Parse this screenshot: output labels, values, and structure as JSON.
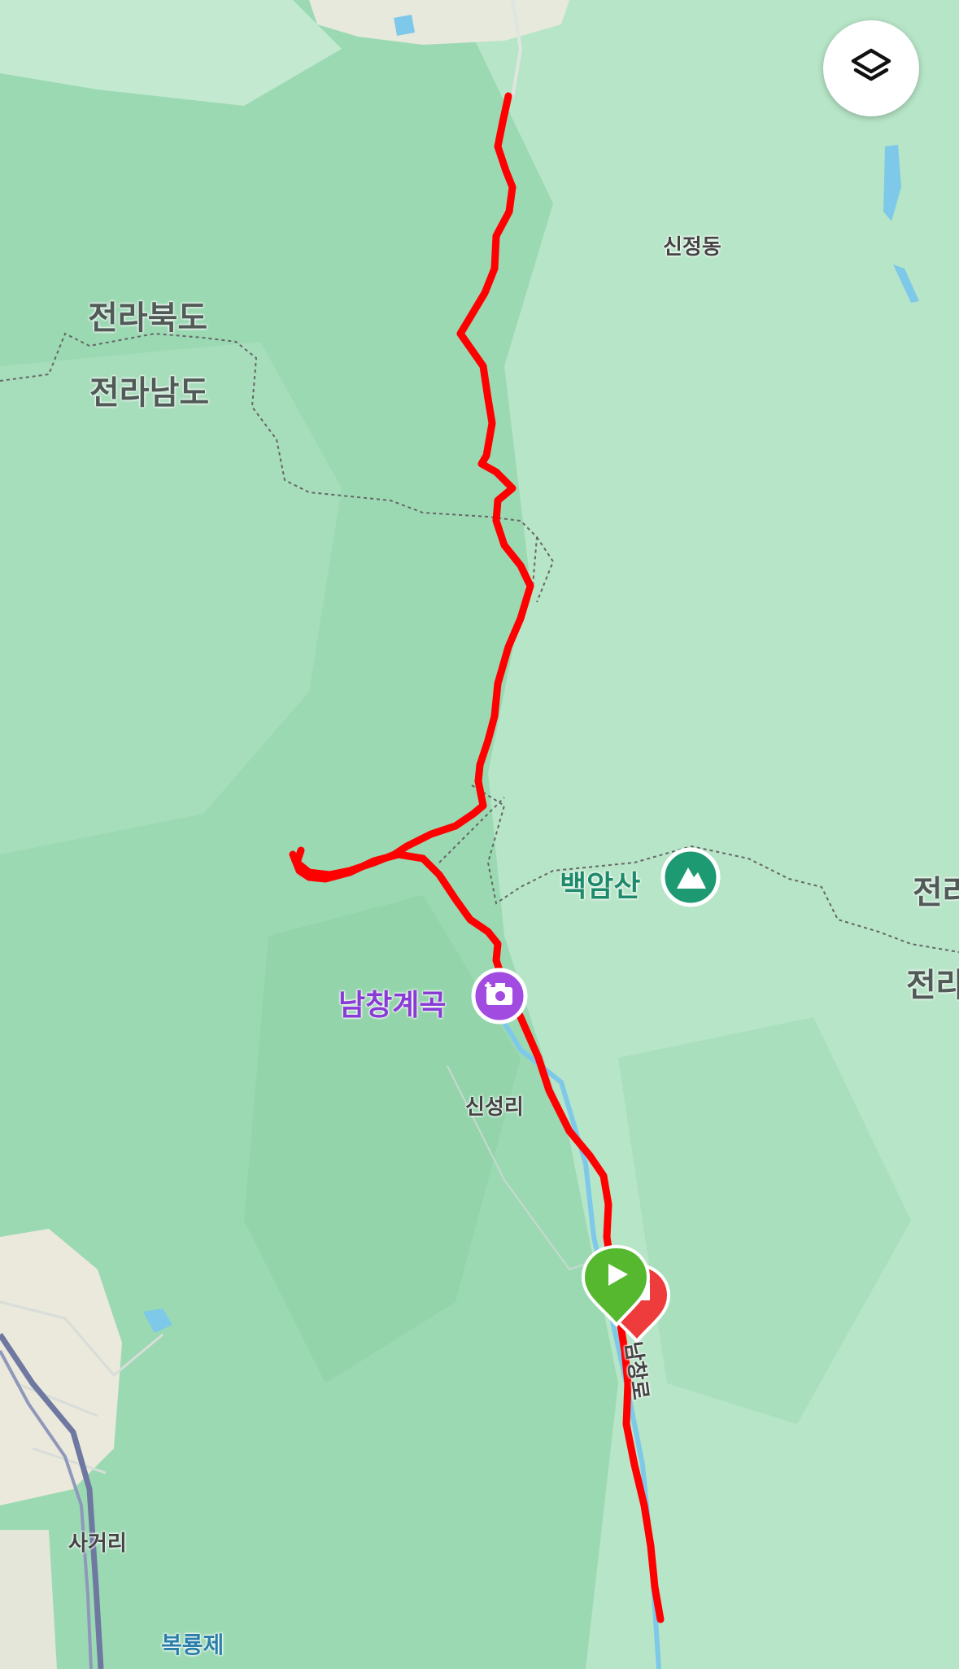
{
  "map": {
    "labels": {
      "region_north": "전라북도",
      "region_south": "전라남도",
      "region_north_right": "전라",
      "region_south_right": "전라",
      "village_sinjeong": "신정동",
      "village_sinseong": "신성리",
      "village_sageori": "사거리",
      "water_bokryongje": "복룡제",
      "road_namchang": "남창로"
    },
    "pois": {
      "mountain": {
        "label": "백암산",
        "icon": "mountain-icon",
        "color": "#1e9a72"
      },
      "valley": {
        "label": "남창계곡",
        "icon": "camera-icon",
        "color": "#a24be0"
      }
    },
    "route": {
      "color": "#ff0000",
      "start_icon": "play-icon",
      "end_icon": "flag-icon"
    },
    "colors": {
      "forest": "#9bd9b3",
      "forest_light": "#b9e6c9",
      "urban": "#ecebe2",
      "water": "#7ec8ea",
      "highway": "#6e78a0"
    }
  },
  "controls": {
    "layers_button": {
      "icon": "layers-icon"
    }
  }
}
